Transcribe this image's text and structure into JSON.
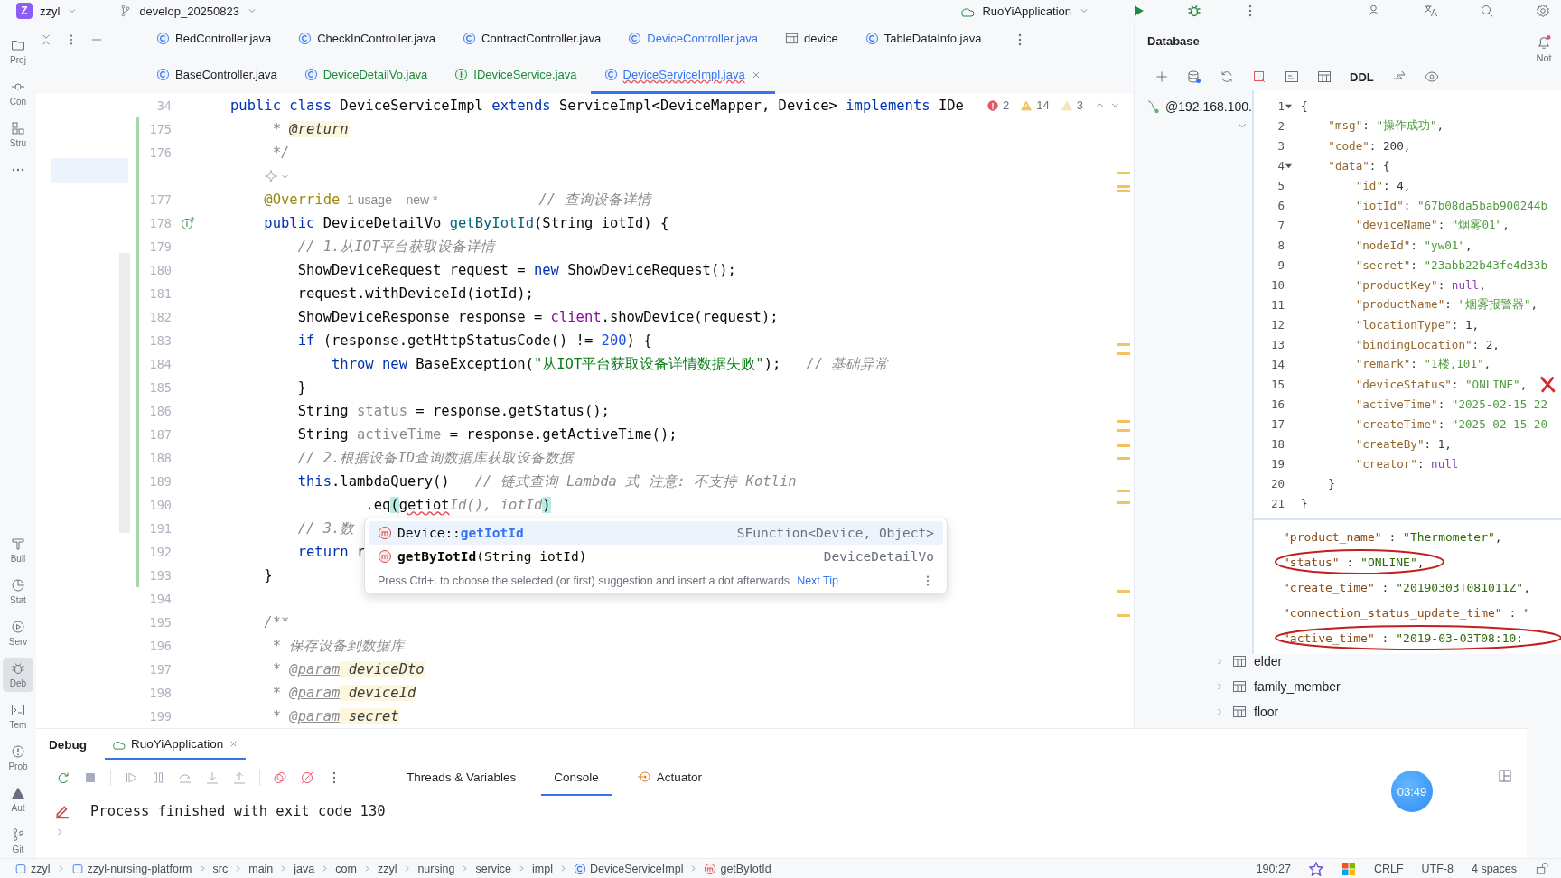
{
  "topbar": {
    "project_badge": "Z",
    "project": "zzyl",
    "branch": "develop_20250823",
    "run_config": "RuoYiApplication"
  },
  "left_toolbar": {
    "top": [
      {
        "kind": "project",
        "label": "Proj",
        "selected": false
      },
      {
        "kind": "commit",
        "label": "Con",
        "selected": false
      },
      {
        "kind": "structure",
        "label": "Stru",
        "selected": false
      },
      {
        "kind": "more",
        "selected": false
      }
    ],
    "bottom": [
      {
        "kind": "build",
        "label": "Buil",
        "selected": false
      },
      {
        "kind": "stat",
        "label": "Stat",
        "selected": false
      },
      {
        "kind": "services",
        "label": "Serv",
        "selected": false
      },
      {
        "kind": "debug",
        "label": "Deb",
        "selected": true
      },
      {
        "kind": "terminal",
        "label": "Tem",
        "selected": false
      },
      {
        "kind": "problems",
        "label": "Prob",
        "selected": false
      },
      {
        "kind": "auto",
        "label": "Aut",
        "selected": false
      },
      {
        "kind": "git",
        "label": "Git",
        "selected": false
      }
    ]
  },
  "editor": {
    "tab_rows": [
      {
        "tabs": [
          {
            "label": "BedController.java",
            "kind": "class",
            "new_file": false,
            "modified": false,
            "selected": false
          },
          {
            "label": "CheckInController.java",
            "kind": "class",
            "new_file": false,
            "modified": false,
            "selected": false
          },
          {
            "label": "ContractController.java",
            "kind": "class",
            "new_file": false,
            "modified": false,
            "selected": false
          },
          {
            "label": "DeviceController.java",
            "kind": "class",
            "new_file": false,
            "modified": true,
            "selected": false
          },
          {
            "label": "device",
            "kind": "table",
            "new_file": false,
            "modified": false,
            "selected": false
          },
          {
            "label": "TableDataInfo.java",
            "kind": "class",
            "new_file": false,
            "modified": false,
            "selected": false
          }
        ]
      },
      {
        "tabs": [
          {
            "label": "BaseController.java",
            "kind": "class",
            "new_file": false,
            "modified": false,
            "selected": false
          },
          {
            "label": "DeviceDetailVo.java",
            "kind": "class",
            "new_file": true,
            "modified": false,
            "selected": false
          },
          {
            "label": "IDeviceService.java",
            "kind": "interface",
            "new_file": true,
            "modified": false,
            "selected": false
          },
          {
            "label": "DeviceServiceImpl.java",
            "kind": "class",
            "new_file": false,
            "modified": true,
            "selected": true
          }
        ]
      }
    ],
    "sticky_line": {
      "number": "34",
      "tokens": [
        {
          "text": "public class",
          "kind": "kw"
        },
        {
          "text": " DeviceServiceImpl ",
          "kind": "pl"
        },
        {
          "text": "extends",
          "kind": "kw"
        },
        {
          "text": " ServiceImpl<DeviceMapper, Device> ",
          "kind": "pl"
        },
        {
          "text": "implements",
          "kind": "kw"
        },
        {
          "text": " IDe",
          "kind": "pl"
        }
      ]
    },
    "inspections": {
      "errors": "2",
      "warnings": "14",
      "weak_warnings": "3"
    },
    "lines": [
      {
        "kind": "code",
        "number": "175",
        "changed": true,
        "tokens": [
          {
            "text": "     * ",
            "kind": "doc"
          },
          {
            "text": "@return",
            "kind": "dp"
          }
        ]
      },
      {
        "kind": "code",
        "number": "176",
        "changed": true,
        "tokens": [
          {
            "text": "     */",
            "kind": "doc"
          }
        ]
      },
      {
        "kind": "ai_hint",
        "changed": true
      },
      {
        "kind": "code",
        "number": "177",
        "changed": true,
        "tokens": [
          {
            "text": "    @Override",
            "kind": "an"
          },
          {
            "text": "  1 usage",
            "kind": "hi"
          },
          {
            "text": "    new *",
            "kind": "hi"
          },
          {
            "text": "            // 查询设备详情",
            "kind": "cm"
          }
        ]
      },
      {
        "kind": "code",
        "number": "178",
        "changed": true,
        "gutter": {
          "kind": "implements"
        },
        "tokens": [
          {
            "text": "    public",
            "kind": "kw"
          },
          {
            "text": " DeviceDetailVo ",
            "kind": "pl"
          },
          {
            "text": "getByIotId",
            "kind": "me"
          },
          {
            "text": "(String iotId) {",
            "kind": "pl"
          }
        ]
      },
      {
        "kind": "code",
        "number": "179",
        "changed": true,
        "tokens": [
          {
            "text": "        // 1.从IOT平台获取设备详情",
            "kind": "cm"
          }
        ]
      },
      {
        "kind": "code",
        "number": "180",
        "changed": true,
        "tokens": [
          {
            "text": "        ShowDeviceRequest request = ",
            "kind": "pl"
          },
          {
            "text": "new",
            "kind": "kw"
          },
          {
            "text": " ShowDeviceRequest();",
            "kind": "pl"
          }
        ]
      },
      {
        "kind": "code",
        "number": "181",
        "changed": true,
        "tokens": [
          {
            "text": "        request.withDeviceId(iotId);",
            "kind": "pl"
          }
        ]
      },
      {
        "kind": "code",
        "number": "182",
        "changed": true,
        "tokens": [
          {
            "text": "        ShowDeviceResponse response = ",
            "kind": "pl"
          },
          {
            "text": "client",
            "kind": "fi"
          },
          {
            "text": ".showDevice(request);",
            "kind": "pl"
          }
        ]
      },
      {
        "kind": "code",
        "number": "183",
        "changed": true,
        "tokens": [
          {
            "text": "        if",
            "kind": "kw"
          },
          {
            "text": " (response.getHttpStatusCode() != ",
            "kind": "pl"
          },
          {
            "text": "200",
            "kind": "nu"
          },
          {
            "text": ") {",
            "kind": "pl"
          }
        ]
      },
      {
        "kind": "code",
        "number": "184",
        "changed": true,
        "tokens": [
          {
            "text": "            throw new",
            "kind": "kw"
          },
          {
            "text": " BaseException(",
            "kind": "pl"
          },
          {
            "text": "\"从IOT平台获取设备详情数据失败\"",
            "kind": "st"
          },
          {
            "text": ");   ",
            "kind": "pl"
          },
          {
            "text": "// 基础异常",
            "kind": "cm"
          }
        ]
      },
      {
        "kind": "code",
        "number": "185",
        "changed": true,
        "tokens": [
          {
            "text": "        }",
            "kind": "pl"
          }
        ]
      },
      {
        "kind": "code",
        "number": "186",
        "changed": true,
        "tokens": [
          {
            "text": "        String ",
            "kind": "pl"
          },
          {
            "text": "status",
            "kind": "un"
          },
          {
            "text": " = response.getStatus();",
            "kind": "pl"
          }
        ]
      },
      {
        "kind": "code",
        "number": "187",
        "changed": true,
        "tokens": [
          {
            "text": "        String ",
            "kind": "pl"
          },
          {
            "text": "activeTime",
            "kind": "un"
          },
          {
            "text": " = response.getActiveTime();",
            "kind": "pl"
          }
        ]
      },
      {
        "kind": "code",
        "number": "188",
        "changed": true,
        "tokens": [
          {
            "text": "        // 2.根据设备ID查询数据库获取设备数据",
            "kind": "cm"
          }
        ]
      },
      {
        "kind": "code",
        "number": "189",
        "changed": true,
        "tokens": [
          {
            "text": "        this",
            "kind": "kw"
          },
          {
            "text": ".lambdaQuery()   ",
            "kind": "pl"
          },
          {
            "text": "// 链式查询 Lambda 式 注意: 不支持 Kotlin",
            "kind": "cm"
          }
        ]
      },
      {
        "kind": "code",
        "number": "190",
        "changed": true,
        "tokens": [
          {
            "text": "                .eq",
            "kind": "pl"
          },
          {
            "text": "(",
            "kind": "mt"
          },
          {
            "text": "getiot",
            "kind": "er"
          },
          {
            "text": "Id(), iotId",
            "kind": "gh"
          },
          {
            "text": ")",
            "kind": "mt"
          }
        ]
      },
      {
        "kind": "code",
        "number": "191",
        "changed": true,
        "tokens": [
          {
            "text": "        // 3.数",
            "kind": "cm"
          }
        ]
      },
      {
        "kind": "code",
        "number": "192",
        "changed": true,
        "tokens": [
          {
            "text": "        return",
            "kind": "kw"
          },
          {
            "text": " r",
            "kind": "pl"
          }
        ]
      },
      {
        "kind": "code",
        "number": "193",
        "changed": true,
        "tokens": [
          {
            "text": "    }",
            "kind": "pl"
          }
        ]
      },
      {
        "kind": "code",
        "number": "194",
        "changed": false
      },
      {
        "kind": "code",
        "number": "195",
        "changed": false,
        "tokens": [
          {
            "text": "    /**",
            "kind": "doc"
          }
        ]
      },
      {
        "kind": "code",
        "number": "196",
        "changed": false,
        "tokens": [
          {
            "text": "     * 保存设备到数据库",
            "kind": "doc"
          }
        ]
      },
      {
        "kind": "code",
        "number": "197",
        "changed": false,
        "tokens": [
          {
            "text": "     * ",
            "kind": "doc"
          },
          {
            "text": "@param",
            "kind": "dt"
          },
          {
            "text": " deviceDto",
            "kind": "dp"
          }
        ]
      },
      {
        "kind": "code",
        "number": "198",
        "changed": false,
        "tokens": [
          {
            "text": "     * ",
            "kind": "doc"
          },
          {
            "text": "@param",
            "kind": "dt"
          },
          {
            "text": " deviceId",
            "kind": "dp"
          }
        ]
      },
      {
        "kind": "code",
        "number": "199",
        "changed": false,
        "tokens": [
          {
            "text": "     * ",
            "kind": "doc"
          },
          {
            "text": "@param",
            "kind": "dt"
          },
          {
            "text": " secret",
            "kind": "dp"
          }
        ]
      }
    ],
    "completion": {
      "items": [
        {
          "parts": [
            {
              "text": "Device::",
              "kind": "plain"
            },
            {
              "text": "getIotId",
              "kind": "match"
            }
          ],
          "type": "SFunction<Device, Object>",
          "selected": true
        },
        {
          "parts": [
            {
              "text": "getByIotId",
              "kind": "name"
            },
            {
              "text": "(String iotId)",
              "kind": "plain"
            }
          ],
          "type": "DeviceDetailVo",
          "selected": false
        }
      ],
      "hint": "Press Ctrl+. to choose the selected (or first) suggestion and insert a dot afterwards",
      "next_tip": "Next Tip"
    }
  },
  "database": {
    "title": "Database",
    "toolbar_label": "DDL",
    "connection": "@192.168.100.",
    "tables": [
      "elder",
      "family_member",
      "floor"
    ]
  },
  "overlay": {
    "json_viewer": [
      {
        "number": "1",
        "fold": true,
        "marked": false,
        "tokens": [
          {
            "text": "{",
            "kind": "jp"
          }
        ]
      },
      {
        "number": "2",
        "fold": false,
        "marked": false,
        "tokens": [
          {
            "text": "    \"msg\"",
            "kind": "jk"
          },
          {
            "text": ": ",
            "kind": "jp"
          },
          {
            "text": "\"操作成功\"",
            "kind": "js"
          },
          {
            "text": ",",
            "kind": "jp"
          }
        ]
      },
      {
        "number": "3",
        "fold": false,
        "marked": false,
        "tokens": [
          {
            "text": "    \"code\"",
            "kind": "jk"
          },
          {
            "text": ": ",
            "kind": "jp"
          },
          {
            "text": "200",
            "kind": "jn"
          },
          {
            "text": ",",
            "kind": "jp"
          }
        ]
      },
      {
        "number": "4",
        "fold": true,
        "marked": false,
        "tokens": [
          {
            "text": "    \"data\"",
            "kind": "jk"
          },
          {
            "text": ": {",
            "kind": "jp"
          }
        ]
      },
      {
        "number": "5",
        "fold": false,
        "marked": false,
        "tokens": [
          {
            "text": "        \"id\"",
            "kind": "jk"
          },
          {
            "text": ": ",
            "kind": "jp"
          },
          {
            "text": "4",
            "kind": "jn"
          },
          {
            "text": ",",
            "kind": "jp"
          }
        ]
      },
      {
        "number": "6",
        "fold": false,
        "marked": false,
        "tokens": [
          {
            "text": "        \"iotId\"",
            "kind": "jk"
          },
          {
            "text": ": ",
            "kind": "jp"
          },
          {
            "text": "\"67b08da5bab900244b",
            "kind": "js"
          }
        ]
      },
      {
        "number": "7",
        "fold": false,
        "marked": false,
        "tokens": [
          {
            "text": "        \"deviceName\"",
            "kind": "jk"
          },
          {
            "text": ": ",
            "kind": "jp"
          },
          {
            "text": "\"烟雾01\"",
            "kind": "js"
          },
          {
            "text": ",",
            "kind": "jp"
          }
        ]
      },
      {
        "number": "8",
        "fold": false,
        "marked": false,
        "tokens": [
          {
            "text": "        \"nodeId\"",
            "kind": "jk"
          },
          {
            "text": ": ",
            "kind": "jp"
          },
          {
            "text": "\"yw01\"",
            "kind": "js"
          },
          {
            "text": ",",
            "kind": "jp"
          }
        ]
      },
      {
        "number": "9",
        "fold": false,
        "marked": false,
        "tokens": [
          {
            "text": "        \"secret\"",
            "kind": "jk"
          },
          {
            "text": ": ",
            "kind": "jp"
          },
          {
            "text": "\"23abb22b43fe4d33b",
            "kind": "js"
          }
        ]
      },
      {
        "number": "10",
        "fold": false,
        "marked": false,
        "tokens": [
          {
            "text": "        \"productKey\"",
            "kind": "jk"
          },
          {
            "text": ": ",
            "kind": "jp"
          },
          {
            "text": "null",
            "kind": "jz"
          },
          {
            "text": ",",
            "kind": "jp"
          }
        ]
      },
      {
        "number": "11",
        "fold": false,
        "marked": false,
        "tokens": [
          {
            "text": "        \"productName\"",
            "kind": "jk"
          },
          {
            "text": ": ",
            "kind": "jp"
          },
          {
            "text": "\"烟雾报警器\"",
            "kind": "js"
          },
          {
            "text": ",",
            "kind": "jp"
          }
        ]
      },
      {
        "number": "12",
        "fold": false,
        "marked": false,
        "tokens": [
          {
            "text": "        \"locationType\"",
            "kind": "jk"
          },
          {
            "text": ": ",
            "kind": "jp"
          },
          {
            "text": "1",
            "kind": "jn"
          },
          {
            "text": ",",
            "kind": "jp"
          }
        ]
      },
      {
        "number": "13",
        "fold": false,
        "marked": false,
        "tokens": [
          {
            "text": "        \"bindingLocation\"",
            "kind": "jk"
          },
          {
            "text": ": ",
            "kind": "jp"
          },
          {
            "text": "2",
            "kind": "jn"
          },
          {
            "text": ",",
            "kind": "jp"
          }
        ]
      },
      {
        "number": "14",
        "fold": false,
        "marked": false,
        "tokens": [
          {
            "text": "        \"remark\"",
            "kind": "jk"
          },
          {
            "text": ": ",
            "kind": "jp"
          },
          {
            "text": "\"1楼,101\"",
            "kind": "js"
          },
          {
            "text": ",",
            "kind": "jp"
          }
        ]
      },
      {
        "number": "15",
        "fold": false,
        "marked": true,
        "tokens": [
          {
            "text": "        \"deviceStatus\"",
            "kind": "jk"
          },
          {
            "text": ": ",
            "kind": "jp"
          },
          {
            "text": "\"ONLINE\"",
            "kind": "js"
          },
          {
            "text": ",",
            "kind": "jp"
          }
        ]
      },
      {
        "number": "16",
        "fold": false,
        "marked": false,
        "tokens": [
          {
            "text": "        \"activeTime\"",
            "kind": "jk"
          },
          {
            "text": ": ",
            "kind": "jp"
          },
          {
            "text": "\"2025-02-15 22",
            "kind": "js"
          }
        ]
      },
      {
        "number": "17",
        "fold": false,
        "marked": false,
        "tokens": [
          {
            "text": "        \"createTime\"",
            "kind": "jk"
          },
          {
            "text": ": ",
            "kind": "jp"
          },
          {
            "text": "\"2025-02-15 20",
            "kind": "js"
          }
        ]
      },
      {
        "number": "18",
        "fold": false,
        "marked": false,
        "tokens": [
          {
            "text": "        \"createBy\"",
            "kind": "jk"
          },
          {
            "text": ": ",
            "kind": "jp"
          },
          {
            "text": "1",
            "kind": "jn"
          },
          {
            "text": ",",
            "kind": "jp"
          }
        ]
      },
      {
        "number": "19",
        "fold": false,
        "marked": false,
        "tokens": [
          {
            "text": "        \"creator\"",
            "kind": "jk"
          },
          {
            "text": ": ",
            "kind": "jp"
          },
          {
            "text": "null",
            "kind": "jz"
          }
        ]
      },
      {
        "number": "20",
        "fold": false,
        "marked": false,
        "tokens": [
          {
            "text": "    }",
            "kind": "jp"
          }
        ]
      },
      {
        "number": "21",
        "fold": false,
        "marked": false,
        "tokens": [
          {
            "text": "}",
            "kind": "jp"
          }
        ]
      }
    ],
    "snippet": [
      {
        "circled": false,
        "tokens": [
          {
            "text": "\"product_name\"",
            "kind": "sk"
          },
          {
            "text": " : ",
            "kind": "jp"
          },
          {
            "text": "\"Thermometer\"",
            "kind": "ss"
          },
          {
            "text": ",",
            "kind": "jp"
          }
        ]
      },
      {
        "circled": true,
        "tokens": [
          {
            "text": "\"status\"",
            "kind": "sk"
          },
          {
            "text": " : ",
            "kind": "jp"
          },
          {
            "text": "\"ONLINE\"",
            "kind": "ss"
          },
          {
            "text": ",",
            "kind": "jp"
          }
        ]
      },
      {
        "circled": false,
        "tokens": [
          {
            "text": "\"create_time\"",
            "kind": "sk"
          },
          {
            "text": " : ",
            "kind": "jp"
          },
          {
            "text": "\"20190303T081011Z\"",
            "kind": "ss"
          },
          {
            "text": ",",
            "kind": "jp"
          }
        ]
      },
      {
        "circled": false,
        "tokens": [
          {
            "text": "\"connection_status_update_time\"",
            "kind": "sk"
          },
          {
            "text": " : ",
            "kind": "jp"
          },
          {
            "text": "\"",
            "kind": "ss"
          }
        ]
      },
      {
        "circled": true,
        "tokens": [
          {
            "text": "\"active_time\"",
            "kind": "sk"
          },
          {
            "text": " : ",
            "kind": "jp"
          },
          {
            "text": "\"2019-03-03T08:10:",
            "kind": "ss"
          }
        ]
      }
    ]
  },
  "debug": {
    "title": "Debug",
    "session_tab": {
      "label": "RuoYiApplication",
      "selected": true
    },
    "tabs": [
      {
        "label": "Threads & Variables",
        "kind": "plain",
        "selected": false
      },
      {
        "label": "Console",
        "kind": "plain",
        "selected": true
      },
      {
        "label": "Actuator",
        "kind": "actuator",
        "selected": false
      }
    ],
    "console": [
      "Process finished with exit code 130"
    ]
  },
  "timer": "03:49",
  "notifications_label": "Not",
  "status_bar": {
    "breadcrumbs": [
      {
        "kind": "module",
        "label": "zzyl"
      },
      {
        "kind": "module",
        "label": "zzyl-nursing-platform"
      },
      {
        "kind": "folder",
        "label": "src"
      },
      {
        "kind": "folder",
        "label": "main"
      },
      {
        "kind": "folder",
        "label": "java"
      },
      {
        "kind": "folder",
        "label": "com"
      },
      {
        "kind": "folder",
        "label": "zzyl"
      },
      {
        "kind": "folder",
        "label": "nursing"
      },
      {
        "kind": "folder",
        "label": "service"
      },
      {
        "kind": "folder",
        "label": "impl"
      },
      {
        "kind": "class",
        "label": "DeviceServiceImpl"
      },
      {
        "kind": "method",
        "label": "getByIotId"
      }
    ],
    "position": "190:27",
    "line_separator": "CRLF",
    "encoding": "UTF-8",
    "indent": "4 spaces"
  }
}
